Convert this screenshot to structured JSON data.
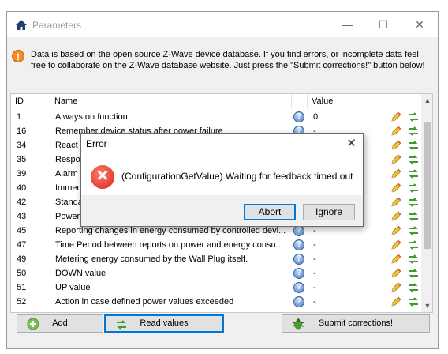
{
  "window": {
    "title": "Parameters",
    "minimize": "—",
    "maximize": "☐",
    "close": "✕"
  },
  "info": {
    "icon": "!",
    "text": "Data is based on the open source Z-Wave device database. If you find errors, or incomplete data feel free to collaborate on the Z-Wave database website. Just press the \"Submit corrections!\" button below!"
  },
  "table": {
    "headers": {
      "id": "ID",
      "name": "Name",
      "value": "Value"
    },
    "help_glyph": "?",
    "rows": [
      {
        "id": "1",
        "name": "Always on function",
        "value": "0"
      },
      {
        "id": "16",
        "name": "Remember device status after power failure",
        "value": "-"
      },
      {
        "id": "34",
        "name": "React to alarms",
        "value": "-"
      },
      {
        "id": "35",
        "name": "Response to alarm frames",
        "value": "-"
      },
      {
        "id": "39",
        "name": "Alarm flashing duration",
        "value": "-"
      },
      {
        "id": "40",
        "name": "Immediate power report",
        "value": "-"
      },
      {
        "id": "42",
        "name": "Standard power reporting",
        "value": "-"
      },
      {
        "id": "43",
        "name": "Power reporting interval",
        "value": "-"
      },
      {
        "id": "45",
        "name": "Reporting changes in energy consumed by controlled devi...",
        "value": "-"
      },
      {
        "id": "47",
        "name": "Time Period between reports on power and energy consu...",
        "value": "-"
      },
      {
        "id": "49",
        "name": "Metering energy consumed by the Wall Plug itself.",
        "value": "-"
      },
      {
        "id": "50",
        "name": "DOWN value",
        "value": "-"
      },
      {
        "id": "51",
        "name": "UP value",
        "value": "-"
      },
      {
        "id": "52",
        "name": "Action in case defined power values exceeded",
        "value": "-"
      }
    ]
  },
  "scrollbar": {
    "up": "▲",
    "down": "▼"
  },
  "buttons": {
    "add": "Add",
    "read": "Read values",
    "submit": "Submit corrections!"
  },
  "dialog": {
    "title": "Error",
    "close": "✕",
    "icon": "✕",
    "message": "(ConfigurationGetValue) Waiting for feedback timed out",
    "abort": "Abort",
    "ignore": "Ignore"
  },
  "colors": {
    "accent": "#0078d7",
    "error": "#d8261b",
    "warning": "#f28c28"
  }
}
